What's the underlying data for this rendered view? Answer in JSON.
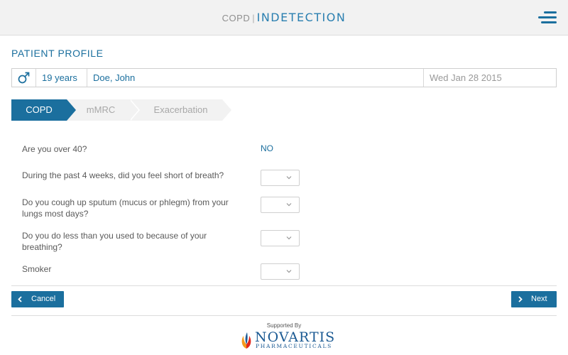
{
  "header": {
    "app_name": "COPD",
    "separator": "|",
    "brand_text": "INDETECTION"
  },
  "page_title": "PATIENT PROFILE",
  "patient": {
    "gender_icon": "male-icon",
    "age": "19 years",
    "name": "Doe, John",
    "date": "Wed Jan 28 2015"
  },
  "steps": [
    {
      "label": "COPD",
      "active": true
    },
    {
      "label": "mMRC",
      "active": false
    },
    {
      "label": "Exacerbation",
      "active": false
    }
  ],
  "questions": [
    {
      "text": "Are you over 40?",
      "answer": "NO"
    },
    {
      "text": "During the past 4 weeks, did you feel short of breath?",
      "answer": ""
    },
    {
      "text": "Do you cough up sputum (mucus or phlegm) from your lungs most days?",
      "answer": ""
    },
    {
      "text": "Do you do less than you used to because of your breathing?",
      "answer": ""
    },
    {
      "text": "Smoker",
      "answer": ""
    }
  ],
  "nav": {
    "cancel_label": "Cancel",
    "next_label": "Next"
  },
  "sponsor": {
    "label": "Supported By",
    "name": "NOVARTIS",
    "subname": "PHARMACEUTICALS"
  },
  "colors": {
    "accent": "#1b6f9e",
    "header_bg": "#f2f2f2",
    "inactive_step_bg": "#f2f2f2"
  }
}
